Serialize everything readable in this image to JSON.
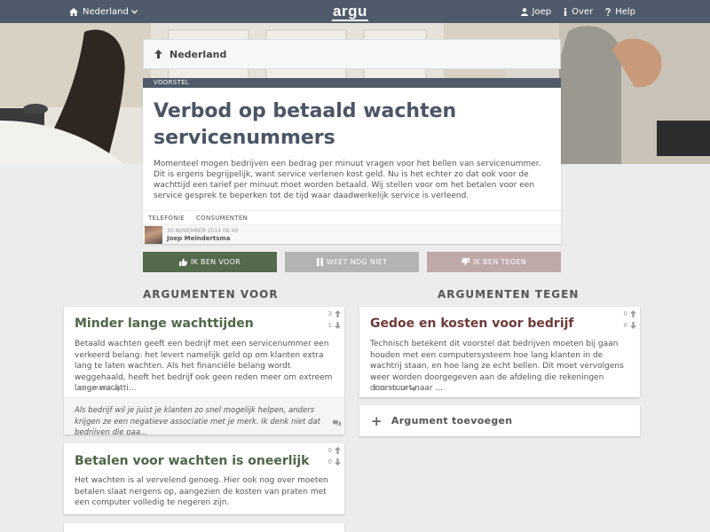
{
  "topbar": {
    "location_label": "Nederland",
    "logo": "argu",
    "user_label": "Joep",
    "about_label": "Over",
    "help_label": "Help"
  },
  "breadcrumb": {
    "label": "Nederland"
  },
  "motion": {
    "type_label": "VOORSTEL",
    "title": "Verbod op betaald wachten servicenummers",
    "body": "Momenteel mogen bedrijven een bedrag per minuut vragen voor het bellen van servicenummer. Dit is ergens begrijpelijk, want service verlenen kost geld. Nu is het echter zo dat ook voor de wachttijd een tarief per minuut moet worden betaald. Wij stellen voor om het betalen voor een service gesprek te beperken tot de tijd waar daadwerkelijk service is verleend.",
    "tags": [
      "TELEFONIE",
      "CONSUMENTEN"
    ],
    "date": "30 NOVEMBER 2014 08:49",
    "author": "Joep Meindertsma"
  },
  "vote": {
    "pro_label": "IK BEN VOOR",
    "neutral_label": "WEET NOG NIET",
    "con_label": "IK BEN TEGEN"
  },
  "columns": {
    "pro_heading": "ARGUMENTEN VOOR",
    "con_heading": "ARGUMENTEN TEGEN"
  },
  "arguments_pro": [
    {
      "title": "Minder lange wachttijden",
      "body": "Betaald wachten geeft een bedrijf met een servicenummer een verkeerd belang: het levert namelijk geld op om klanten extra lang te laten wachten. Als het financiële belang wordt weggehaald, heeft het bedrijf ook geen reden meer om extreem lange wachtti...",
      "read_more": "LEES MEER",
      "upvotes": "3",
      "downvotes": "1",
      "comment": "Als bedrijf wil je juist je klanten zo snel mogelijk helpen, anders krijgen ze een negatieve associatie met je merk. Ik denk niet dat bedrijven die paa..."
    },
    {
      "title": "Betalen voor wachten is oneerlijk",
      "body": "Het wachten is al vervelend genoeg. Hier ook nog over moeten betalen slaat nergens op, aangezien de kosten van praten met een computer volledig te negeren zijn.",
      "upvotes": "0",
      "downvotes": "0"
    }
  ],
  "arguments_con": [
    {
      "title": "Gedoe en kosten voor bedrijf",
      "body": "Technisch betekent dit voorstel dat bedrijven moeten bij gaan houden met een computersysteem hoe lang klanten in de wachtrij staan, en hoe lang ze echt bellen. Dit moet vervolgens weer worden doorgegeven aan de afdeling die rekeningen doorstuurt naar ...",
      "read_more": "LEES MEER",
      "upvotes": "0",
      "downvotes": "0"
    }
  ],
  "add_argument_label": "Argument toevoegen"
}
